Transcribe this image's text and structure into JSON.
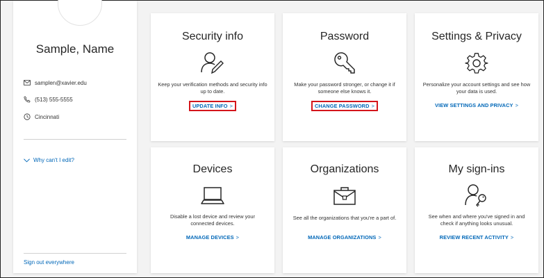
{
  "profile": {
    "name": "Sample, Name",
    "email": "samplen@xavier.edu",
    "phone": "(513) 555-5555",
    "location": "Cincinnati",
    "why_link": "Why can't I edit?",
    "signout_link": "Sign out everywhere"
  },
  "tiles": {
    "security": {
      "title": "Security info",
      "desc": "Keep your verification methods and security info up to date.",
      "link": "UPDATE INFO"
    },
    "password": {
      "title": "Password",
      "desc": "Make your password stronger, or change it if someone else knows it.",
      "link": "CHANGE PASSWORD"
    },
    "settings": {
      "title": "Settings & Privacy",
      "desc": "Personalize your account settings and see how your data is used.",
      "link": "VIEW SETTINGS AND PRIVACY"
    },
    "devices": {
      "title": "Devices",
      "desc": "Disable a lost device and review your connected devices.",
      "link": "MANAGE DEVICES"
    },
    "organizations": {
      "title": "Organizations",
      "desc": "See all the organizations that you're a part of.",
      "link": "MANAGE ORGANIZATIONS"
    },
    "signins": {
      "title": "My sign-ins",
      "desc": "See when and where you've signed in and check if anything looks unusual.",
      "link": "REVIEW RECENT ACTIVITY"
    }
  },
  "chevron": ">",
  "colors": {
    "link": "#0067b8",
    "highlight": "#d4151b"
  }
}
